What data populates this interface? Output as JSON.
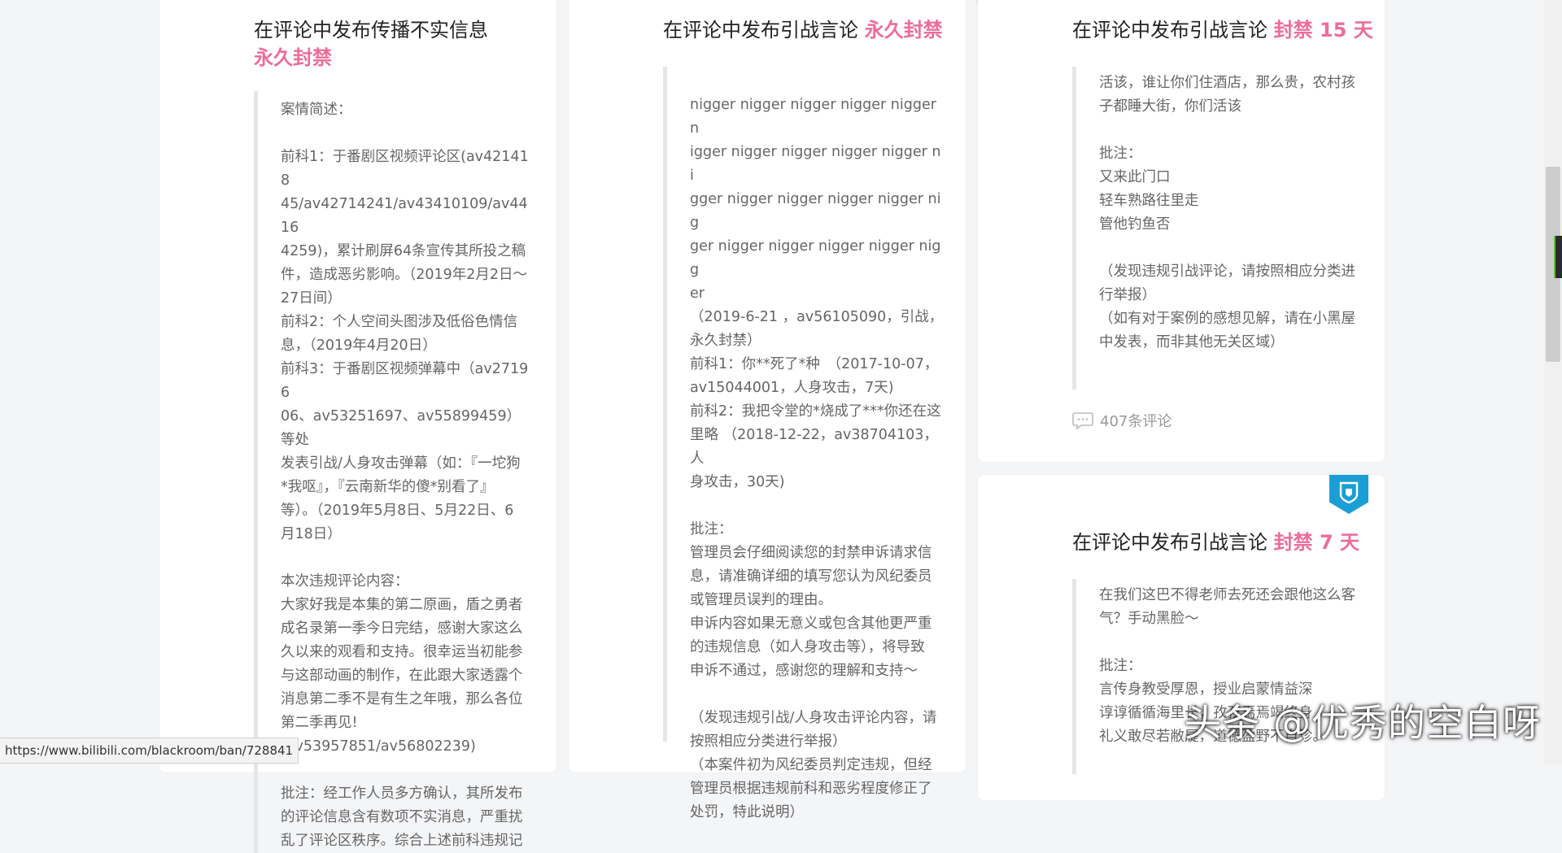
{
  "cards": [
    {
      "title": "在评论中发布传播不实信息",
      "penalty": "永久封禁",
      "lines": [
        "案情简述：",
        "",
        "前科1：于番剧区视频评论区(av421418",
        "45/av42714241/av43410109/av4416",
        "4259)，累计刷屏64条宣传其所投之稿",
        "件，造成恶劣影响。（2019年2月2日～",
        "27日间）",
        "前科2：个人空间头图涉及低俗色情信",
        "息，（2019年4月20日）",
        "前科3：于番剧区视频弹幕中（av27196",
        "06、av53251697、av55899459）等处",
        "发表引战/人身攻击弹幕（如：『一坨狗",
        "*我呕』，『云南新华的傻*别看了』",
        "等）。（2019年5月8日、5月22日、6",
        "月18日）",
        "",
        "本次违规评论内容：",
        "大家好我是本集的第二原画，盾之勇者",
        "成名录第一季今日完结，感谢大家这么",
        "久以来的观看和支持。很幸运当初能参",
        "与这部动画的制作，在此跟大家透露个",
        "消息第二季不是有生之年哦，那么各位",
        "第二季再见!",
        "(av53957851/av56802239)",
        "",
        "批注：经工作人员多方确认，其所发布",
        "的评论信息含有数项不实消息，严重扰",
        "乱了评论区秩序。综合上述前科违规记"
      ]
    },
    {
      "title": "在评论中发布引战言论",
      "penalty": "永久封禁",
      "lines": [
        "nigger nigger nigger nigger nigger n",
        "igger nigger nigger nigger nigger ni",
        "gger nigger nigger nigger nigger nig",
        "ger nigger nigger nigger nigger nigg",
        "er",
        "（2019-6-21 ，av56105090，引战，",
        "永久封禁）",
        "前科1：你**死了*种　（2017-10-07，",
        "av15044001，人身攻击，7天)",
        "前科2：我把令堂的*烧成了***你还在这",
        "里略 （2018-12-22，av38704103，人",
        "身攻击，30天)",
        "",
        "批注：",
        "管理员会仔细阅读您的封禁申诉请求信",
        "息，请准确详细的填写您认为风纪委员",
        "或管理员误判的理由。",
        "申诉内容如果无意义或包含其他更严重",
        "的违规信息（如人身攻击等），将导致",
        "申诉不通过，感谢您的理解和支持～",
        "",
        "（发现违规引战/人身攻击评论内容，请",
        "按照相应分类进行举报）",
        "（本案件初为风纪委员判定违规，但经",
        "管理员根据违规前科和恶劣程度修正了",
        "处罚，特此说明）"
      ]
    },
    {
      "title": "在评论中发布引战言论",
      "penalty": "封禁 15 天",
      "lines": [
        "活该，谁让你们住酒店，那么贵，农村孩",
        "子都睡大街，你们活该",
        "",
        "批注：",
        "又来此门口",
        "轻车熟路往里走",
        "管他钓鱼否",
        "",
        "（发现违规引战评论，请按照相应分类进",
        "行举报）",
        "（如有对于案例的感想见解，请在小黑屋",
        "中发表，而非其他无关区域）"
      ],
      "comments": "407条评论"
    },
    {
      "title": "在评论中发布引战言论",
      "penalty": "封禁 7 天",
      "lines": [
        "在我们这巴不得老师去死还会跟他这么客",
        "气？手动黑脸～",
        "",
        "批注：",
        "言传身教受厚恩，授业启蒙情益深",
        "谆谆循循海里长，孜孜焉焉竭终身",
        "礼义敢尽若敝屣，道德盈野不自珍。"
      ]
    }
  ],
  "status_url": "https://www.bilibili.com/blackroom/ban/728841",
  "watermark": "头条 @优秀的空白呀"
}
